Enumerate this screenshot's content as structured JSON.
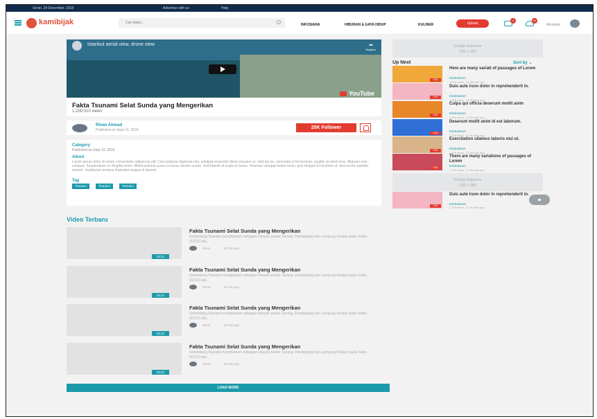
{
  "topbar": {
    "date": "Senin, 24 Desember, 2018",
    "advertise": "Advertise with us",
    "help": "Help"
  },
  "header": {
    "logo": "kamibijak",
    "search_placeholder": "Cari disini...",
    "nav": [
      "INFOSIANA",
      "HIBURAN & GAYA HIDUP",
      "KULINER"
    ],
    "upload_label": "Upload",
    "message_count": "4",
    "notification_count": "16",
    "username": "Abraham"
  },
  "video": {
    "player_title": "Istanbul aerial view, drone view",
    "share_label": "Bagikan",
    "youtube_label": "YouTube",
    "title": "Fakta Tsunami Selat Sunda yang Mengerikan",
    "views": "1,200,010 views"
  },
  "author": {
    "name": "Rivan Ahmad",
    "published": "Published on Sept 10, 2018",
    "follow_label": "20K Follower"
  },
  "details": {
    "category_label": "Category",
    "category_published": "Published on Sept 10, 2018",
    "about_label": "About",
    "about_text": "Lorem ipsum dolor sit amet, consectetur adipiscing elit. Cras pulvinar dignissim dui, volutpat venenatis libero posuere ut. Sed dui ex, venenatis ut fermentum, sagittis sit amet eros. Aliquam erat volutpat. Suspendisse ac fringilla lorem. Morbi pulvinar purus eu lacus dictum auctor. Sed blandit at turpis id varius. Vivamus volutpat metus lacus, quis feugiat mi tincidunt ut. Sed auctor porttitor laoreet. Vestibulum tempus imperdiet magna id laoreet.",
    "tag_label": "Tag",
    "tags": [
      "Tsunami",
      "Tsunami",
      "Tsunami"
    ]
  },
  "latest": {
    "title": "Video Terbaru",
    "items": [
      {
        "title": "Fakta Tsunami Selat Sunda yang Mengerikan",
        "desc": "Gelombang Tsunami menghantam sebagian wilayah pesisir Serang, Pandeglang dan Lampung Selatan pada Sabtu (22/12) lalu.",
        "author": "Rivan",
        "time": "60 min ago",
        "duration": "03:22"
      },
      {
        "title": "Fakta Tsunami Selat Sunda yang Mengerikan",
        "desc": "Gelombang Tsunami menghantam sebagian wilayah pesisir Serang, Pandeglang dan Lampung Selatan pada Sabtu (22/12) lalu.",
        "author": "Rivan",
        "time": "20 min ago",
        "duration": "03:22"
      },
      {
        "title": "Fakta Tsunami Selat Sunda yang Mengerikan",
        "desc": "Gelombang Tsunami menghantam sebagian wilayah pesisir Serang, Pandeglang dan Lampung Selatan pada Sabtu (22/12) lalu.",
        "author": "Rivan",
        "time": "20 min ago",
        "duration": "03:22"
      },
      {
        "title": "Fakta Tsunami Selat Sunda yang Mengerikan",
        "desc": "Gelombang Tsunami menghantam sebagian wilayah pesisir Serang, Pandeglang dan Lampung Selatan pada Sabtu (22/12) lalu.",
        "author": "Rivan",
        "time": "20 min ago",
        "duration": "03:22"
      }
    ],
    "load_more": "LOAD MORE"
  },
  "sidebar": {
    "ad_title": "Google Adsense",
    "ad_size": "336 x 280",
    "up_next": "Up Next",
    "sort_by": "Sort by",
    "items": [
      {
        "title": "Here are many variati of passages of Lorem",
        "category": "Edukatainet",
        "meta": "1,200 views · 11 Months ago",
        "duration": "3:00",
        "color": "#f0a83a"
      },
      {
        "title": "Duis aute irure dolor in reprehenderit in.",
        "category": "Edukatainet",
        "meta": "1,200 views · 11 Months ago",
        "duration": "3:00",
        "color": "#f4b6c2"
      },
      {
        "title": "Culpa qui officia deserunt mollit anim",
        "category": "Edukatainet",
        "meta": "1,200 views · 11 Months ago",
        "duration": "3:00",
        "color": "#e8862a"
      },
      {
        "title": "Deserunt mollit anim id est laborum.",
        "category": "Edukatainet",
        "meta": "1,200 views · 11 Months ago",
        "duration": "3:00",
        "color": "#2f6fd6"
      },
      {
        "title": "Exercitation ullamco laboris nisi ut.",
        "category": "Edukatainet",
        "meta": "1,200 views · 11 Months ago",
        "duration": "3:00",
        "color": "#d9b48a"
      },
      {
        "title": "There are many variations of passages of Lorem",
        "category": "Edukatainet",
        "meta": "1,200 views · 11 Months ago",
        "duration": "3:00",
        "color": "#c94a5a"
      }
    ],
    "last_item": {
      "title": "Duis aute irure dolor in reprehenderit in.",
      "category": "Edukatainet",
      "meta": "1,200 views · 11 Months ago",
      "duration": "3:00",
      "color": "#f4b6c2"
    }
  }
}
